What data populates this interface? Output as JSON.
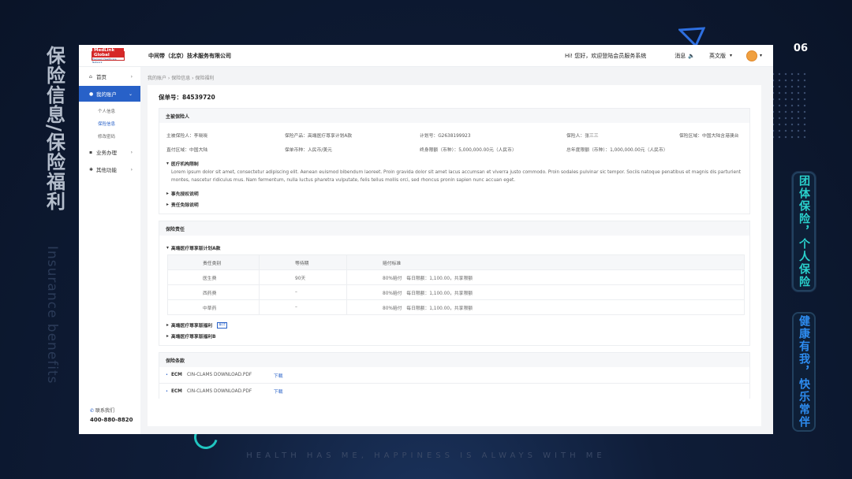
{
  "slide": {
    "title_cn": "保险信息/保险福利",
    "title_en": "Insurance benefits",
    "page_number": "06",
    "tag_1": "团体保险，个人保险",
    "tag_2": "健康有我，快乐常伴",
    "footer": "HEALTH HAS ME, HAPPINESS IS ALWAYS WITH ME"
  },
  "header": {
    "logo_text": "MedLink Global",
    "logo_sub": "Premium Healthcare Network",
    "company": "中间带（北京）技术服务有限公司",
    "welcome": "Hi! 您好，欢迎登陆会员服务系统",
    "messages": "消息",
    "language": "英文版"
  },
  "sidebar": {
    "items": [
      {
        "label": "首页"
      },
      {
        "label": "我的账户"
      },
      {
        "label": "业务办理"
      },
      {
        "label": "其他功能"
      }
    ],
    "sub_items": [
      {
        "label": "个人信息"
      },
      {
        "label": "保险信息"
      },
      {
        "label": "修改密码"
      }
    ],
    "contact_label": "联系我们",
    "phone": "400-880-8820"
  },
  "breadcrumb": "我的账户 › 保险信息 › 保险福利",
  "policy": {
    "number_label": "保单号：84539720",
    "insured_section": {
      "title": "主被保险人",
      "fields": [
        "主被保险人：李晓晓",
        "保险产品：高端医疗尊享计划A款",
        "计划号：G2638199923",
        "保险人：张三三",
        "保险区域：中国大陆含港澳台",
        "直付区域：中国大陆",
        "保单币种：人民币/美元",
        "终身限额（币种）：5,000,000.00元（人民币）",
        "总年度限额（币种）：1,000,000.00元（人民币）"
      ],
      "medical_limit_title": "医疗机构限制",
      "lorem": "Lorem ipsum dolor sit amet, consectetur adipiscing elit. Aenean euismod bibendum laoreet. Proin gravida dolor sit amet lacus accumsan et viverra justo commodo. Proin sodales pulvinar sic tempor. Sociis natoque penatibus et magnis dis parturient montes, nascetur ridiculus mus. Nam fermentum, nulla luctus pharetra vulputate, felis tellus mollis orci, sed rhoncus pronin sapien nunc accuan eget.",
      "prior_auth": "事先授权说明",
      "exemption": "责任免除说明"
    },
    "liability_section": {
      "title": "保险责任",
      "plan_a": "高端医疗尊享版计划A款",
      "table_headers": [
        "责任类别",
        "等待期",
        "赔付标准"
      ],
      "rows": [
        [
          "医生费",
          "90天",
          "80%赔付　每日限额：1,100.00，共享限额"
        ],
        [
          "西药费",
          "–",
          "80%赔付　每日限额：1,100.00，共享限额"
        ],
        [
          "中草药",
          "–",
          "80%赔付　每日限额：1,100.00，共享限额"
        ]
      ],
      "plan_welfare": "高端医疗尊享版福利",
      "plan_welfare_badge": "家计",
      "plan_b": "高端医疗尊享版福利B"
    },
    "clauses_section": {
      "title": "保险条款",
      "items": [
        {
          "tag": "ECM",
          "file": "CIN-CLAMS DOWNLOAD.PDF",
          "action": "下载"
        },
        {
          "tag": "ECM",
          "file": "CIN-CLAMS DOWNLOAD.PDF",
          "action": "下载"
        }
      ]
    }
  },
  "colors": {
    "accent": "#2861c8",
    "teal": "#2ad1cc",
    "background": "#0f1d38"
  }
}
